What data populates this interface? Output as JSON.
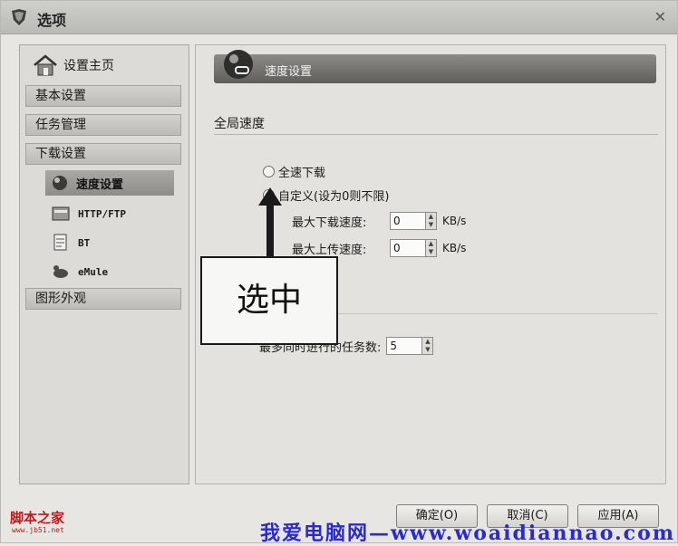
{
  "window": {
    "title": "选项"
  },
  "sidebar": {
    "home": "设置主页",
    "basic": "基本设置",
    "task": "任务管理",
    "download": "下载设置",
    "sub_items": [
      "速度设置",
      "HTTP/FTP",
      "BT",
      "eMule"
    ],
    "appearance": "图形外观"
  },
  "content": {
    "header_title": "速度设置",
    "section_title": "全局速度",
    "radio_full": "全速下载",
    "radio_custom": "自定义(设为0则不限)",
    "max_download_label": "最大下载速度:",
    "max_download_value": "0",
    "max_upload_label": "最大上传速度:",
    "max_upload_value": "0",
    "unit": "KB/s",
    "max_tasks_label": "最多同时进行的任务数:",
    "max_tasks_value": "5"
  },
  "annotation": {
    "callout_text": "选中"
  },
  "buttons": {
    "ok": "确定(O)",
    "cancel": "取消(C)",
    "apply": "应用(A)"
  },
  "watermark": {
    "left": "脚本之家",
    "left_url": "www.jb51.net",
    "bottom": "我爱电脑网—www.woaidiannao.com"
  }
}
